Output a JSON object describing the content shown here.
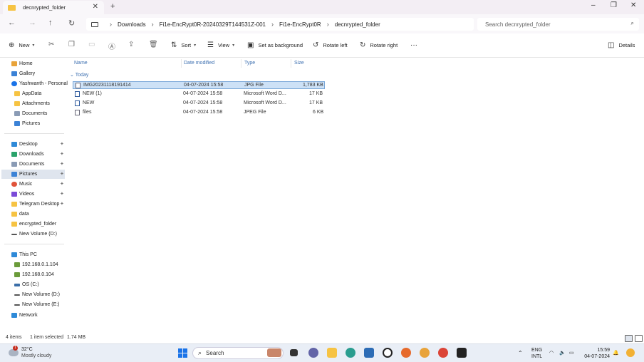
{
  "tab": {
    "title": "decnrypted_folder",
    "close": "✕",
    "new": "+"
  },
  "window": {
    "minimize": "–",
    "maximize": "❐",
    "close": "✕"
  },
  "nav": {
    "back": "←",
    "forward": "→",
    "up": "↑",
    "refresh": "↻"
  },
  "breadcrumbs": [
    "Downloads",
    "Fi1e-EncRypt0R-20240329T144531Z-001",
    "Fi1e-EncRypt0R",
    "decnrypted_folder"
  ],
  "search": {
    "placeholder": "Search decnrypted_folder"
  },
  "toolbar": {
    "new": "New",
    "sort": "Sort",
    "view": "View",
    "set_background": "Set as background",
    "rotate_left": "Rotate left",
    "rotate_right": "Rotate right",
    "more": "···",
    "details": "Details"
  },
  "sidebar": {
    "quick": [
      {
        "label": "Home"
      },
      {
        "label": "Gallery"
      },
      {
        "label": "Yashwanth - Personal"
      },
      {
        "label": "AppData"
      },
      {
        "label": "Attachments"
      },
      {
        "label": "Documents"
      },
      {
        "label": "Pictures"
      }
    ],
    "pinned": [
      {
        "label": "Desktop"
      },
      {
        "label": "Downloads"
      },
      {
        "label": "Documents"
      },
      {
        "label": "Pictures"
      },
      {
        "label": "Music"
      },
      {
        "label": "Videos"
      },
      {
        "label": "Telegram Desktop"
      },
      {
        "label": "data"
      },
      {
        "label": "encrypted_folder"
      },
      {
        "label": "New Volume (D:)"
      }
    ],
    "pc": [
      {
        "label": "This PC"
      },
      {
        "label": "192.168.0.1.104"
      },
      {
        "label": "192.168.0.104"
      },
      {
        "label": "OS (C:)"
      },
      {
        "label": "New Volume (D:)"
      },
      {
        "label": "New Volume (E:)"
      },
      {
        "label": "Network"
      }
    ]
  },
  "columns": {
    "name": "Name",
    "date": "Date modified",
    "type": "Type",
    "size": "Size"
  },
  "group": "Today",
  "files": [
    {
      "name": "IMG20231118191414",
      "date": "04-07-2024 15:58",
      "type": "JPG File",
      "size": "1,783 KB"
    },
    {
      "name": "NEW (1)",
      "date": "04-07-2024 15:58",
      "type": "Microsoft Word D...",
      "size": "17 KB"
    },
    {
      "name": "NEW",
      "date": "04-07-2024 15:58",
      "type": "Microsoft Word D...",
      "size": "17 KB"
    },
    {
      "name": "files",
      "date": "04-07-2024 15:58",
      "type": "JPEG File",
      "size": "6 KB"
    }
  ],
  "status": {
    "items": "4 items",
    "selected": "1 item selected",
    "size": "1.74 MB"
  },
  "taskbar": {
    "weather_temp": "32°C",
    "weather_desc": "Mostly cloudy",
    "weather_badge": "1",
    "search": "Search",
    "lang1": "ENG",
    "lang2": "INTL",
    "time": "15:59",
    "date": "04-07-2024"
  },
  "colors": {
    "accent": "#1a73e8",
    "selection": "#cde1f6",
    "folder": "#f6c343"
  }
}
